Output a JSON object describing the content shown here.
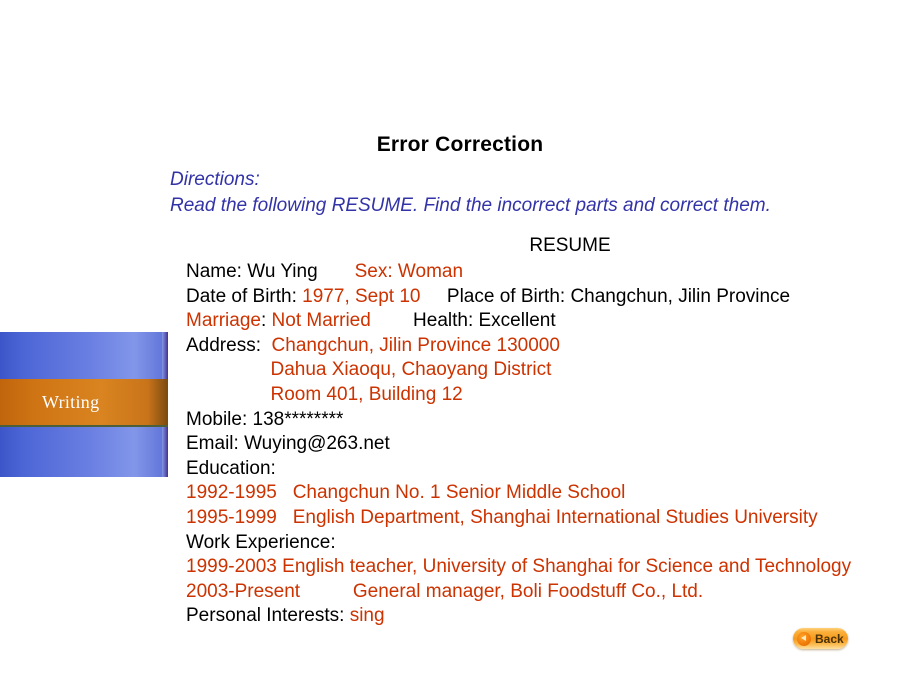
{
  "slide": {
    "title": "Error Correction",
    "background_color": "#ffffff"
  },
  "colors": {
    "red": "#cc3300",
    "black": "#000000",
    "directions_blue": "#3333a8",
    "panel_blue": "#5b72dd",
    "tab_orange": "#cf7414",
    "back_button_orange": "#f59a1e"
  },
  "directions": {
    "heading": "Directions:",
    "text": "Read the following RESUME. Find the incorrect parts and correct them."
  },
  "resume": {
    "heading": "RESUME",
    "lines": [
      {
        "id": "name-sex",
        "segments": [
          {
            "text": "Name: Wu Ying",
            "color": "black"
          },
          {
            "text": "       ",
            "color": "black"
          },
          {
            "text": "Sex: Woman",
            "color": "red"
          }
        ]
      },
      {
        "id": "birth",
        "segments": [
          {
            "text": "Date of Birth: ",
            "color": "black"
          },
          {
            "text": "1977, Sept 10",
            "color": "red"
          },
          {
            "text": "     Place of Birth: Changchun, Jilin Province",
            "color": "black"
          }
        ]
      },
      {
        "id": "marriage-health",
        "segments": [
          {
            "text": "Marriage",
            "color": "red"
          },
          {
            "text": ": ",
            "color": "black"
          },
          {
            "text": "Not Married",
            "color": "red"
          },
          {
            "text": "        Health: Excellent",
            "color": "black"
          }
        ]
      },
      {
        "id": "address-1",
        "segments": [
          {
            "text": "Address:  ",
            "color": "black"
          },
          {
            "text": "Changchun, Jilin Province 130000",
            "color": "red"
          }
        ]
      },
      {
        "id": "address-2",
        "segments": [
          {
            "text": "                ",
            "color": "black"
          },
          {
            "text": "Dahua Xiaoqu, Chaoyang District",
            "color": "red"
          }
        ]
      },
      {
        "id": "address-3",
        "segments": [
          {
            "text": "                ",
            "color": "black"
          },
          {
            "text": "Room 401, Building 12",
            "color": "red"
          }
        ]
      },
      {
        "id": "mobile",
        "segments": [
          {
            "text": "Mobile: 138********",
            "color": "black"
          }
        ]
      },
      {
        "id": "email",
        "segments": [
          {
            "text": "Email: Wuying@263.net",
            "color": "black"
          }
        ]
      },
      {
        "id": "education-label",
        "segments": [
          {
            "text": "Education:",
            "color": "black"
          }
        ]
      },
      {
        "id": "education-1",
        "segments": [
          {
            "text": "1992-1995   Changchun No. 1 Senior Middle School",
            "color": "red"
          }
        ]
      },
      {
        "id": "education-2",
        "segments": [
          {
            "text": "1995-1999   English Department, Shanghai International Studies University",
            "color": "red"
          }
        ]
      },
      {
        "id": "work-label",
        "segments": [
          {
            "text": "Work Experience:",
            "color": "black"
          }
        ]
      },
      {
        "id": "work-1",
        "segments": [
          {
            "text": "1999-2003 English teacher, University of Shanghai for Science and Technology",
            "color": "red"
          }
        ]
      },
      {
        "id": "work-2",
        "segments": [
          {
            "text": "2003-Present          General manager, Boli Foodstuff Co., Ltd.",
            "color": "red"
          }
        ]
      },
      {
        "id": "interests",
        "segments": [
          {
            "text": "Personal Interests: ",
            "color": "black"
          },
          {
            "text": "sing",
            "color": "red"
          }
        ]
      }
    ]
  },
  "side_tab": {
    "label": "Writing"
  },
  "back_button": {
    "label": "Back",
    "icon": "triangle-left-icon"
  }
}
